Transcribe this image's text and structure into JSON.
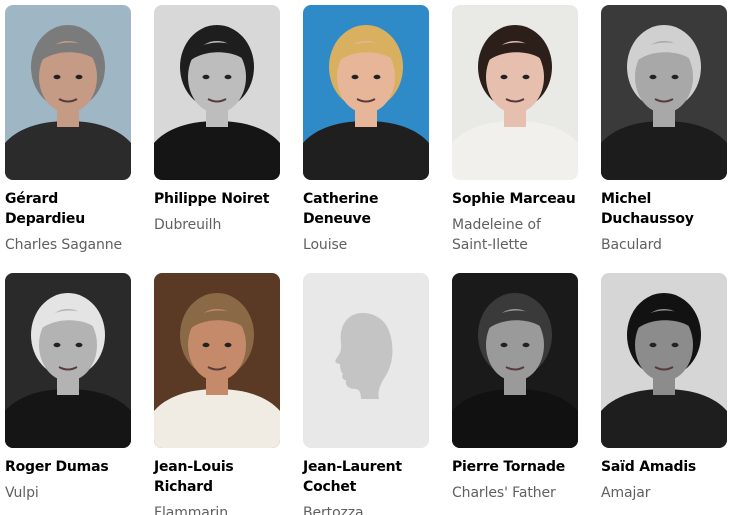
{
  "cast": [
    {
      "name": "Gérard Depardieu",
      "role": "Charles Saganne",
      "photo": "actor-headshot",
      "bg": "#9fb6c4",
      "skin": "#c59b86",
      "hair": "#7b7b7b",
      "cloth": "#2b2b2b"
    },
    {
      "name": "Philippe Noiret",
      "role": "Dubreuilh",
      "photo": "actor-headshot",
      "bg": "#d8d8d8",
      "skin": "#bdbdbd",
      "hair": "#1e1e1e",
      "cloth": "#151515"
    },
    {
      "name": "Catherine Deneuve",
      "role": "Louise",
      "photo": "actor-headshot",
      "bg": "#2e8bc8",
      "skin": "#e7b597",
      "hair": "#d9b060",
      "cloth": "#1f1f1f"
    },
    {
      "name": "Sophie Marceau",
      "role": "Madeleine of Saint-Ilette",
      "photo": "actor-headshot",
      "bg": "#e9e9e6",
      "skin": "#e6bfae",
      "hair": "#2c1f1a",
      "cloth": "#f2f0ec"
    },
    {
      "name": "Michel Duchaussoy",
      "role": "Baculard",
      "photo": "actor-headshot",
      "bg": "#3a3a3a",
      "skin": "#a8a8a8",
      "hair": "#d0d0d0",
      "cloth": "#1c1c1c"
    },
    {
      "name": "Roger Dumas",
      "role": "Vulpi",
      "photo": "actor-headshot",
      "bg": "#2a2a2a",
      "skin": "#b3b3b3",
      "hair": "#e4e4e4",
      "cloth": "#151515"
    },
    {
      "name": "Jean-Louis Richard",
      "role": "Flammarin",
      "photo": "actor-headshot",
      "bg": "#5a3a24",
      "skin": "#c48a6a",
      "hair": "#8a6a46",
      "cloth": "#f0ece4"
    },
    {
      "name": "Jean-Laurent Cochet",
      "role": "Bertozza",
      "photo": "placeholder-silhouette",
      "bg": "#e8e8e8",
      "skin": "#c4c4c4",
      "hair": "#c4c4c4",
      "cloth": "#c4c4c4"
    },
    {
      "name": "Pierre Tornade",
      "role": "Charles' Father",
      "photo": "actor-headshot",
      "bg": "#1a1a1a",
      "skin": "#9a9a9a",
      "hair": "#3a3a3a",
      "cloth": "#111111"
    },
    {
      "name": "Saïd Amadis",
      "role": "Amajar",
      "photo": "actor-headshot",
      "bg": "#d6d6d6",
      "skin": "#8c8c8c",
      "hair": "#121212",
      "cloth": "#1e1e1e"
    }
  ]
}
